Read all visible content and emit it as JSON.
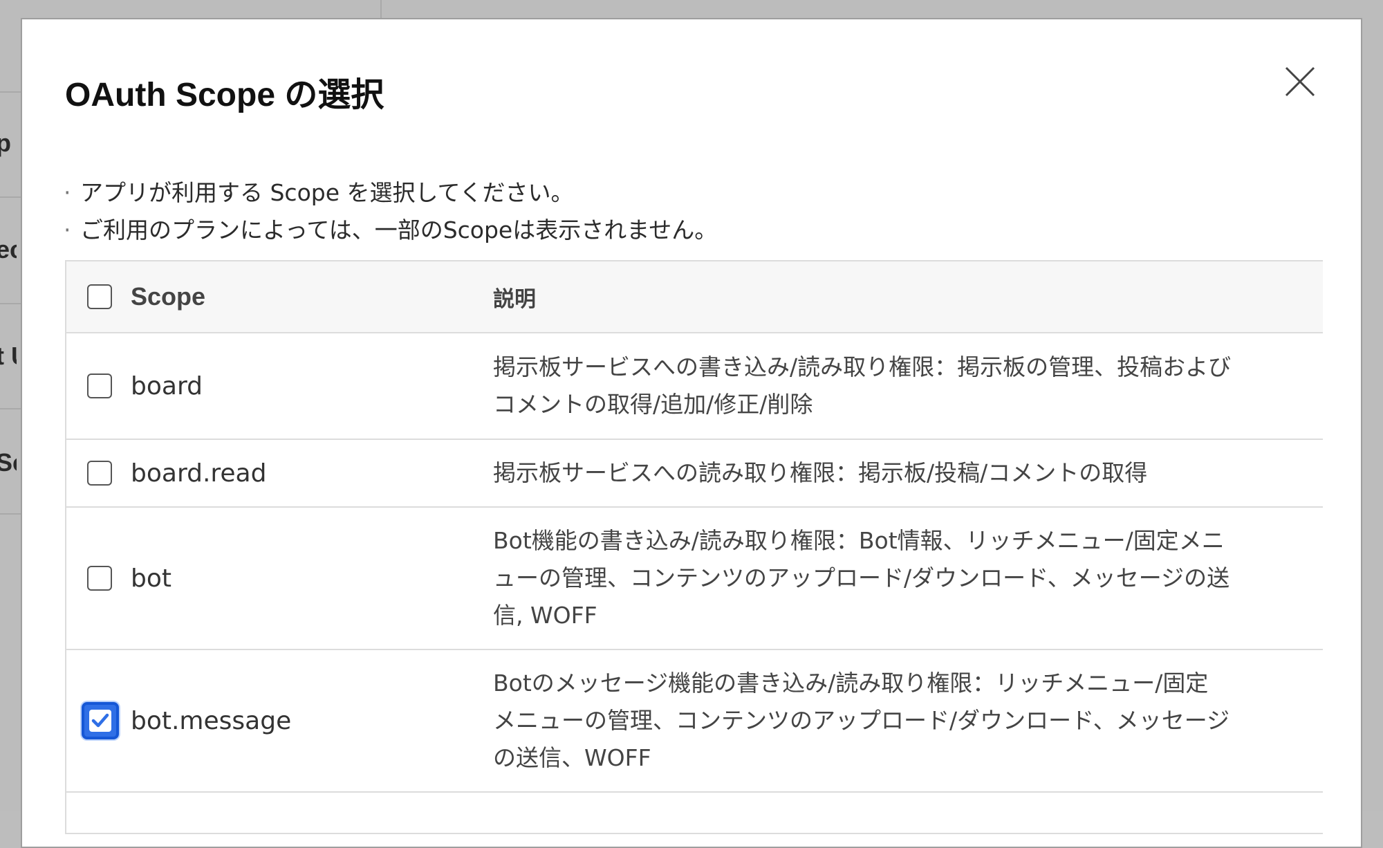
{
  "background": {
    "fragments": [
      "p",
      "ec",
      "t U",
      "Sc"
    ]
  },
  "modal": {
    "title": "OAuth Scope の選択",
    "notes": [
      "アプリが利用する Scope を選択してください。",
      "ご利用のプランによっては、一部のScopeは表示されません。"
    ]
  },
  "table": {
    "headers": {
      "scope": "Scope",
      "description": "説明"
    },
    "rows": [
      {
        "scope": "board",
        "description": "掲示板サービスへの書き込み/読み取り権限：掲示板の管理、投稿および\nコメントの取得/追加/修正/削除",
        "checked": false
      },
      {
        "scope": "board.read",
        "description": "掲示板サービスへの読み取り権限：掲示板/投稿/コメントの取得",
        "checked": false
      },
      {
        "scope": "bot",
        "description": "Bot機能の書き込み/読み取り権限：Bot情報、リッチメニュー/固定メニ\nューの管理、コンテンツのアップロード/ダウンロード、メッセージの送\n信, WOFF",
        "checked": false
      },
      {
        "scope": "bot.message",
        "description": "Botのメッセージ機能の書き込み/読み取り権限：リッチメニュー/固定\nメニューの管理、コンテンツのアップロード/ダウンロード、メッセージ\nの送信、WOFF",
        "checked": true
      }
    ]
  },
  "colors": {
    "accent": "#2f6fe6"
  },
  "icons": {
    "close": "close-icon",
    "check": "checkmark-icon"
  }
}
